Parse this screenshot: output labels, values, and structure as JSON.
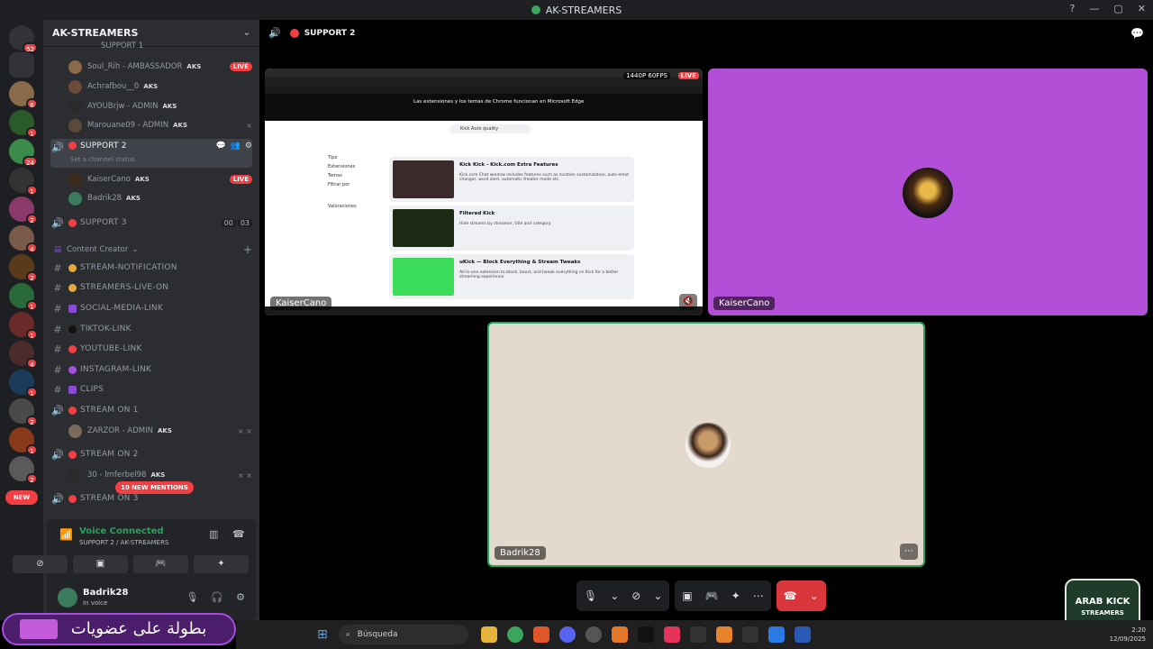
{
  "window": {
    "title": "AK-STREAMERS"
  },
  "rail": {
    "badges": [
      "52",
      "6",
      "1",
      "24",
      "1",
      "2",
      "4",
      "2",
      "1",
      "1",
      "4",
      "1",
      "2",
      "1",
      "2"
    ],
    "new_label": "NEW"
  },
  "server": {
    "name": "AK-STREAMERS"
  },
  "channels": {
    "support1_partial": "SUPPORT 1",
    "support1_users": [
      {
        "name": "Soul_Rih - AMBASSADOR",
        "tag": "AKS",
        "live": "LIVE"
      },
      {
        "name": "Achrafbou__0",
        "tag": "AKS"
      },
      {
        "name": "AYOUBrjw - ADMIN",
        "tag": "AKS"
      },
      {
        "name": "Marouane09 - ADMIN",
        "tag": "AKS"
      }
    ],
    "support2": {
      "name": "SUPPORT 2",
      "status": "Set a channel status"
    },
    "support2_users": [
      {
        "name": "KaiserCano",
        "tag": "AKS",
        "live": "LIVE"
      },
      {
        "name": "Badrik28",
        "tag": "AKS"
      }
    ],
    "support3": {
      "name": "SUPPORT 3",
      "count_a": "00",
      "count_b": "03"
    },
    "category": "Content Creator",
    "text_channels": [
      "STREAM-NOTIFICATION",
      "STREAMERS-LIVE-ON",
      "SOCIAL-MEDIA-LINK",
      "TIKTOK-LINK",
      "YOUTUBE-LINK",
      "INSTAGRAM-LINK",
      "CLIPS"
    ],
    "stream1": {
      "name": "STREAM ON 1",
      "user": "ZARZOR - ADMIN",
      "tag": "AKS"
    },
    "stream2": {
      "name": "STREAM ON 2",
      "user": "30 - lmferbel98",
      "tag": "AKS"
    },
    "stream3_partial": "STREAM ON 3",
    "mentions": "10 NEW MENTIONS"
  },
  "voice": {
    "title": "Voice Connected",
    "subtitle": "SUPPORT 2 / AK-STREAMERS"
  },
  "user": {
    "name": "Badrik28",
    "status": "In voice"
  },
  "banner": {
    "text": "بطولة على عضويات"
  },
  "main": {
    "channel": "SUPPORT 2",
    "tiles": [
      {
        "label": "KaiserCano",
        "kind": "screen"
      },
      {
        "label": "KaiserCano",
        "kind": "avatar"
      },
      {
        "label": "Badrik28",
        "kind": "avatar"
      }
    ],
    "screen": {
      "fps": "1440P 60FPS",
      "live": "LIVE",
      "edge_banner": "Las extensiones y los temas de Chrome funcionan en Microsoft Edge",
      "search": "Kick Auto quality",
      "filters": [
        "Tipo",
        "Extensiones",
        "Temas",
        "Filtrar por",
        "Valoraciones"
      ],
      "extensions": [
        {
          "title": "Kick Kick - Kick.com Extra Features",
          "desc": "Kick.com Chat window includes features such as location customization, auto-emot changer, word alert, automatic theater mode etc.",
          "thumb": "#3a2a2a"
        },
        {
          "title": "Filtered Kick",
          "desc": "Hide streams by streamer, title and category.",
          "thumb": "#1b2a12"
        },
        {
          "title": "uKick — Block Everything & Stream Tweaks",
          "desc": "All-in-one extension to block, boost, and tweak everything on Kick for a better streaming experience.",
          "thumb": "#3bdc5a"
        }
      ]
    }
  },
  "taskbar": {
    "search": "Búsqueda",
    "time": "2:20",
    "date": "12/09/2025"
  },
  "corner_logo": {
    "line1": "ARAB KICK",
    "line2": "STREAMERS"
  },
  "colors": {
    "accent_red": "#f23f43",
    "voice_green": "#23a55a",
    "tile_purple": "#b34ed6"
  }
}
